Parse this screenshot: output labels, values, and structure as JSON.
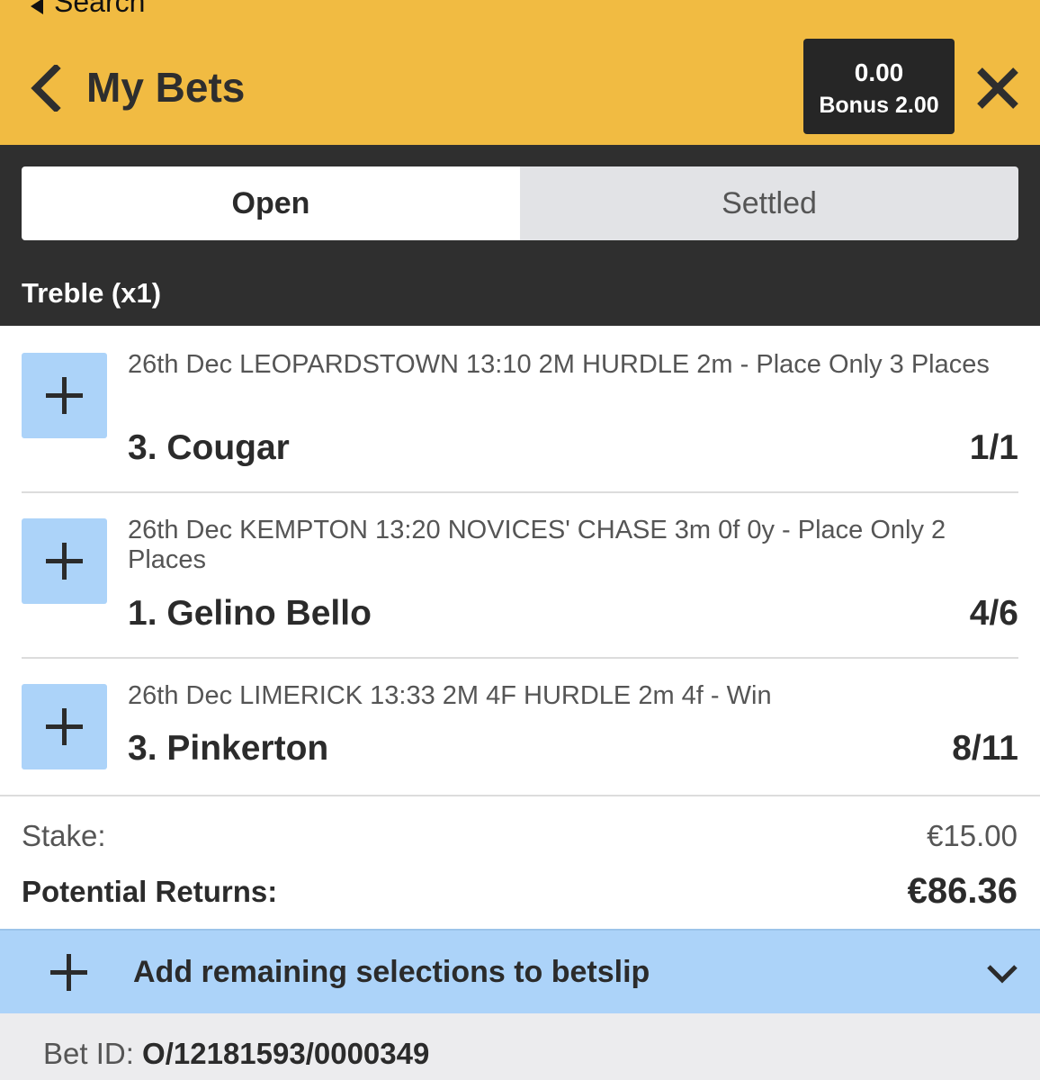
{
  "header": {
    "back_label": "Search",
    "title": "My Bets",
    "balance": "0.00",
    "bonus": "Bonus  2.00"
  },
  "tabs": [
    {
      "label": "Open"
    },
    {
      "label": "Settled"
    }
  ],
  "bet": {
    "type": "Treble (x1)",
    "selections": [
      {
        "event": "26th Dec LEOPARDSTOWN 13:10 2M HURDLE 2m - Place Only 3 Places",
        "runner": "3. Cougar",
        "odds": "1/1"
      },
      {
        "event": "26th Dec KEMPTON 13:20 NOVICES' CHASE 3m 0f 0y - Place Only 2 Places",
        "runner": "1. Gelino Bello",
        "odds": "4/6"
      },
      {
        "event": "26th Dec LIMERICK 13:33 2M 4F HURDLE 2m 4f - Win",
        "runner": "3. Pinkerton",
        "odds": "8/11"
      }
    ],
    "stake_label": "Stake:",
    "stake_value": "€15.00",
    "returns_label": "Potential Returns:",
    "returns_value": "€86.36"
  },
  "add_remaining": {
    "label": "Add remaining selections to betslip"
  },
  "footer": {
    "bet_id_label": "Bet ID: ",
    "bet_id_value": "O/12181593/0000349"
  },
  "colors": {
    "header_yellow": "#f1bb42",
    "dark_band": "#2f2f2f",
    "plus_blue": "#acd3f9",
    "footer_gray": "#ececee"
  },
  "icons": [
    "back-triangle-icon",
    "chevron-left-icon",
    "close-icon",
    "plus-icon",
    "chevron-down-icon"
  ]
}
